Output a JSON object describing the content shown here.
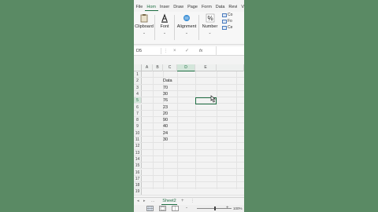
{
  "tabs": [
    "File",
    "Hom",
    "Inser",
    "Draw",
    "Page",
    "Form",
    "Data",
    "Revi",
    "View"
  ],
  "active_tab_index": 1,
  "ribbon": {
    "groups": [
      {
        "label": "Clipboard",
        "icon": "clipboard-icon"
      },
      {
        "label": "Font",
        "icon": "font-icon"
      },
      {
        "label": "Alignment",
        "icon": "alignment-icon"
      },
      {
        "label": "Number",
        "icon": "percent-icon"
      }
    ],
    "styles": [
      "Co",
      "Fo",
      "Ce"
    ]
  },
  "formula_bar": {
    "name_box": "D5",
    "cancel": "×",
    "enter": "✓",
    "fx": "fx",
    "value": ""
  },
  "columns": [
    "A",
    "B",
    "C",
    "D",
    "E"
  ],
  "selected_column": "D",
  "rows": [
    {
      "n": "1",
      "b": ""
    },
    {
      "n": "2",
      "b": "Data"
    },
    {
      "n": "3",
      "b": "70"
    },
    {
      "n": "4",
      "b": "30"
    },
    {
      "n": "5",
      "b": "76"
    },
    {
      "n": "6",
      "b": "23"
    },
    {
      "n": "7",
      "b": "20"
    },
    {
      "n": "8",
      "b": "90"
    },
    {
      "n": "9",
      "b": "40"
    },
    {
      "n": "10",
      "b": "24"
    },
    {
      "n": "11",
      "b": "30"
    },
    {
      "n": "12",
      "b": ""
    },
    {
      "n": "13",
      "b": ""
    },
    {
      "n": "14",
      "b": ""
    },
    {
      "n": "15",
      "b": ""
    },
    {
      "n": "16",
      "b": ""
    },
    {
      "n": "17",
      "b": ""
    },
    {
      "n": "18",
      "b": ""
    },
    {
      "n": "19",
      "b": ""
    }
  ],
  "selected_row": "5",
  "sheet": {
    "tab": "Sheet2",
    "prev": "...",
    "add": "+"
  },
  "status": {
    "zoom": "100%",
    "minus": "-",
    "plus": "+"
  },
  "colors": {
    "accent": "#1f6e43",
    "background": "#5a8a64"
  }
}
